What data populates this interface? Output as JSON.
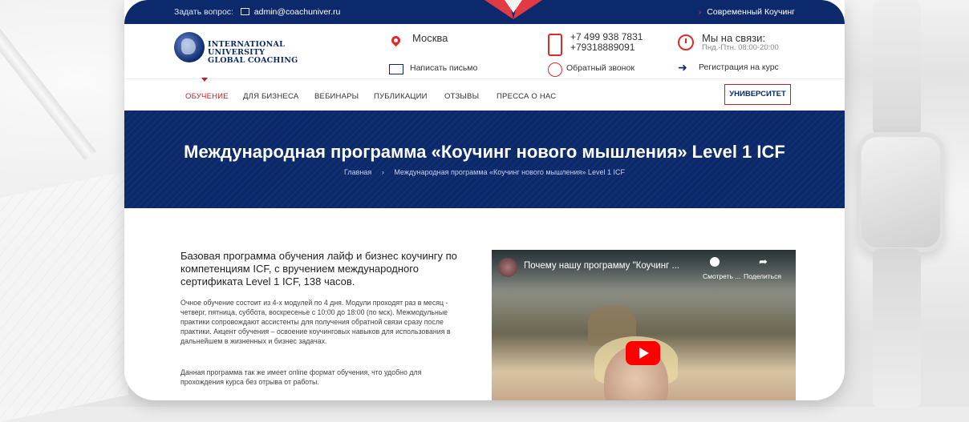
{
  "topbar": {
    "ask_label": "Задать вопрос:",
    "email": "admin@coachuniver.ru",
    "right_link": "Современный Коучинг"
  },
  "logo": {
    "line1": "INTERNATIONAL",
    "line2": "UNIVERSITY",
    "line3": "GLOBAL COACHING"
  },
  "header": {
    "city": "Москва",
    "write_letter": "Написать письмо",
    "phone1": "+7 499 938 7831",
    "phone2": "+79318889091",
    "callback": "Обратный звонок",
    "online_title": "Мы на связи:",
    "online_hours": "Пнд.-Птн. 08:00-20:00",
    "registration": "Регистрация на курс"
  },
  "nav": {
    "items": [
      {
        "label": "ОБУЧЕНИЕ"
      },
      {
        "label": "ДЛЯ БИЗНЕСА"
      },
      {
        "label": "ВЕБИНАРЫ"
      },
      {
        "label": "ПУБЛИКАЦИИ"
      },
      {
        "label": "ОТЗЫВЫ"
      },
      {
        "label": "ПРЕССА О НАС"
      }
    ],
    "university_button": "УНИВЕРСИТЕТ ⌄"
  },
  "hero": {
    "title": "Международная программа «Коучинг нового мышления» Level 1 ICF",
    "breadcrumb_home": "Главная",
    "breadcrumb_sep": "›",
    "breadcrumb_current": "Международная программа «Коучинг нового мышления» Level 1 ICF"
  },
  "content": {
    "lead": "Базовая программа обучения лайф и бизнес коучингу по компетенциям ICF, с вручением международного сертификата Level 1 ICF, 138 часов.",
    "para1": "Очное обучение состоит из 4-х модулей по 4 дня. Модули проходят раз в месяц - четверг, пятница, суббота, воскресенье с 10:00 до 18:00 (по мск). Межмодульные практики сопровождают ассистенты для получения обратной связи сразу после практики. Акцент обучения – освоение коучинговых навыков для использования в дальнейшем в жизненных и бизнес задачах.",
    "para2": "Данная программа так же имеет online формат обучения, что удобно для прохождения курса без отрыва от работы."
  },
  "video": {
    "title": "Почему нашу программу \"Коучинг ...",
    "watch_later": "Смотреть ...",
    "share": "Поделиться"
  },
  "colors": {
    "navy": "#0c2a6b",
    "accent_red": "#c31f27",
    "play_red": "#ff0000"
  }
}
